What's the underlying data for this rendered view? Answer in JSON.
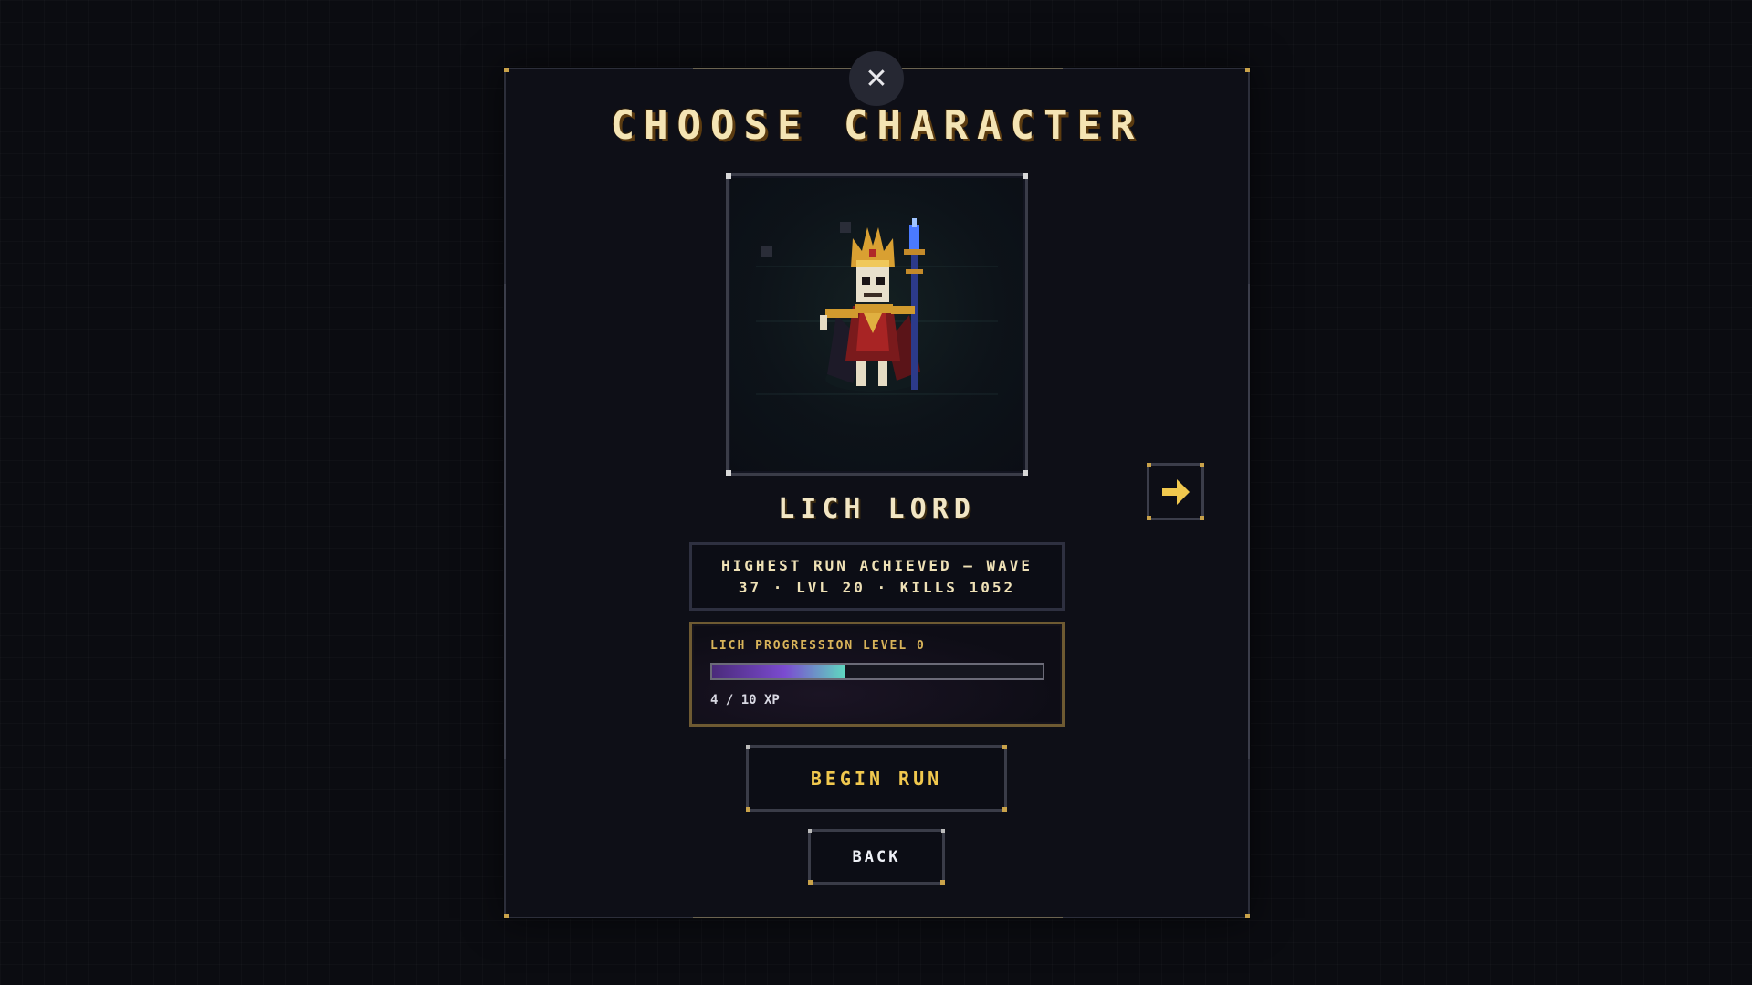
{
  "dialog": {
    "title": "CHOOSE CHARACTER",
    "close_icon": "close-icon"
  },
  "character": {
    "name": "LICH LORD",
    "portrait_icon": "lich-lord-sprite"
  },
  "stats": {
    "text": "HIGHEST RUN ACHIEVED — WAVE 37 · LVL 20 · KILLS 1052"
  },
  "progression": {
    "label": "LICH PROGRESSION LEVEL 0",
    "xp_text": "4 / 10 XP",
    "xp_current": 4,
    "xp_max": 10
  },
  "buttons": {
    "begin_label": "BEGIN RUN",
    "back_label": "BACK",
    "next_icon": "arrow-right-icon"
  },
  "colors": {
    "accent_gold": "#f1c84e",
    "title_cream": "#f4e4b4",
    "progress_purple": "#7b4bd0",
    "progress_teal": "#5fd6c0"
  }
}
